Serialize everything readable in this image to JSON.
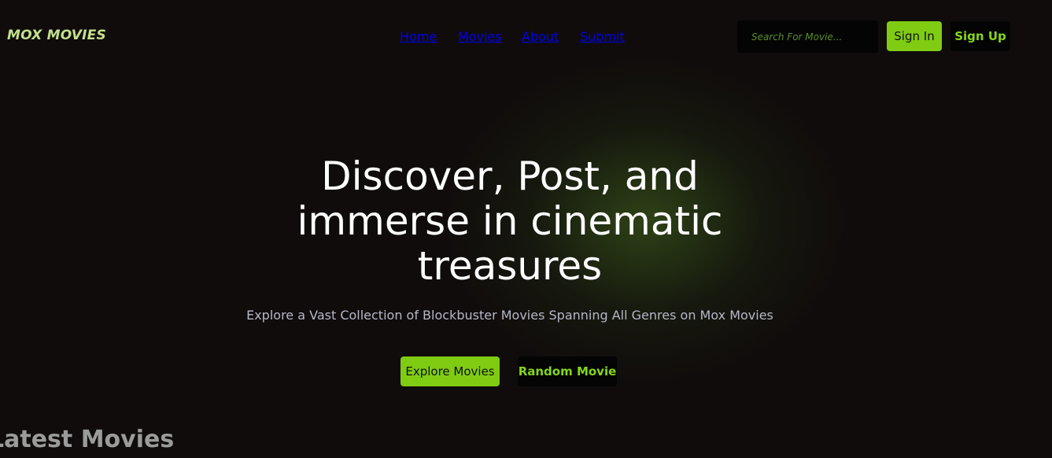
{
  "brand": {
    "logo_text": "MOX MOVIES"
  },
  "nav": {
    "items": [
      {
        "label": "Home"
      },
      {
        "label": "Movies"
      },
      {
        "label": "About"
      },
      {
        "label": "Submit"
      }
    ]
  },
  "search": {
    "placeholder": "Search For Movie...",
    "value": ""
  },
  "auth": {
    "sign_in_label": "Sign In",
    "sign_up_label": "Sign Up"
  },
  "hero": {
    "title": "Discover, Post, and immerse in cinematic treasures",
    "subtitle": "Explore a Vast Collection of Blockbuster Movies Spanning All Genres on Mox Movies",
    "explore_label": "Explore Movies",
    "random_label": "Random Movie"
  },
  "sections": {
    "latest_title": "Latest Movies"
  },
  "colors": {
    "background": "#100c0c",
    "accent": "#7fcc12",
    "logo": "#c4e08c"
  }
}
